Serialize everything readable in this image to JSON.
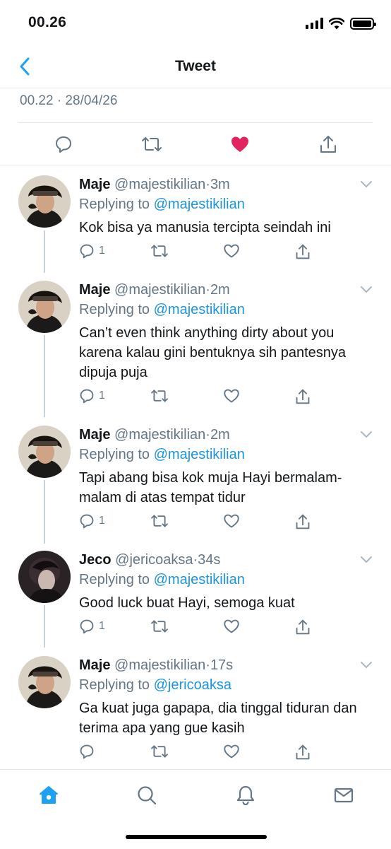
{
  "status_bar": {
    "time": "00.26"
  },
  "header": {
    "title": "Tweet"
  },
  "tweet": {
    "timestamp": "00.22 · 28/04/26"
  },
  "colors": {
    "accent": "#1da1f2",
    "like": "#e0245e",
    "text": "#14171a",
    "muted": "#657786"
  },
  "replies": [
    {
      "name": "Maje",
      "handle": "@majestikilian",
      "time": "3m",
      "replying_prefix": "Replying to",
      "replying_to": "@majestikilian",
      "text": "Kok bisa ya manusia tercipta seindah ini",
      "reply_count": "1"
    },
    {
      "name": "Maje",
      "handle": "@majestikilian",
      "time": "2m",
      "replying_prefix": "Replying to",
      "replying_to": "@majestikilian",
      "text": "Can’t even think anything dirty about you karena kalau gini bentuknya sih pantesnya dipuja puja",
      "reply_count": "1"
    },
    {
      "name": "Maje",
      "handle": "@majestikilian",
      "time": "2m",
      "replying_prefix": "Replying to",
      "replying_to": "@majestikilian",
      "text": "Tapi abang bisa kok muja Hayi bermalam-malam di atas tempat tidur",
      "reply_count": "1"
    },
    {
      "name": "Jeco",
      "handle": "@jericoaksa",
      "time": "34s",
      "replying_prefix": "Replying to",
      "replying_to": "@majestikilian",
      "text": "Good luck buat Hayi, semoga kuat",
      "reply_count": "1"
    },
    {
      "name": "Maje",
      "handle": "@majestikilian",
      "time": "17s",
      "replying_prefix": "Replying to",
      "replying_to": "@jericoaksa",
      "text": "Ga kuat juga gapapa, dia tinggal tiduran dan terima apa yang gue kasih",
      "reply_count": ""
    }
  ],
  "tabs": [
    "home-icon",
    "search-icon",
    "notifications-icon",
    "messages-icon"
  ]
}
